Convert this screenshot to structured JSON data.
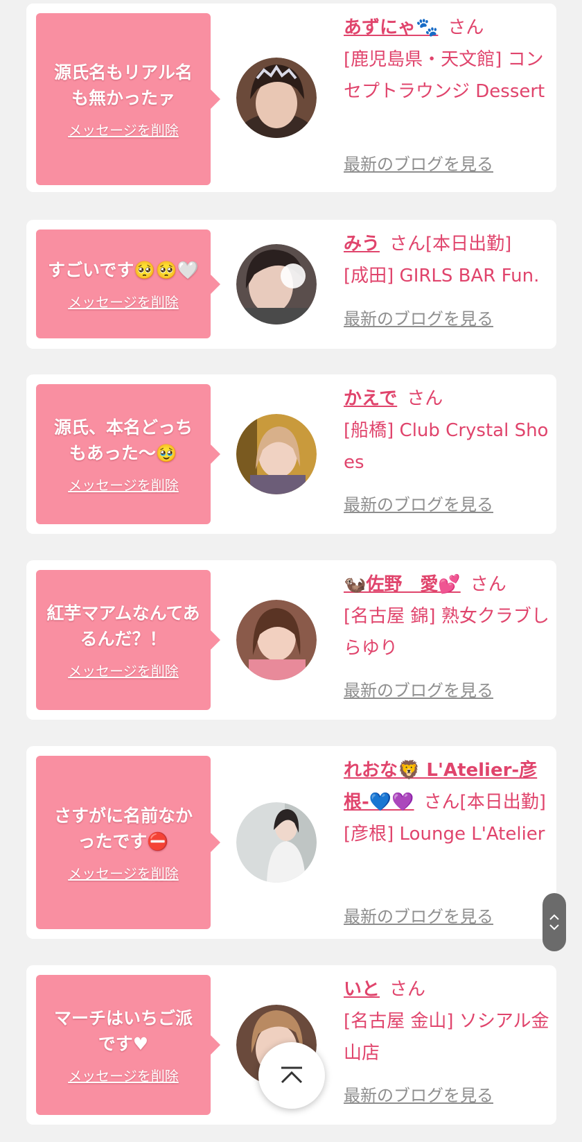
{
  "colors": {
    "background": "#f1f1f1",
    "bubble": "#f98fa1",
    "accent": "#e0446c",
    "link_gray": "#8e8e8e"
  },
  "items": [
    {
      "message": "源氏名もリアル名も無かったァ",
      "delete_label": "メッセージを削除",
      "name": "あずにゃ🐾",
      "suffix": "さん",
      "shop": "[鹿児島県・天文館] コンセプトラウンジ Dessert",
      "blog_label": "最新のブログを見る"
    },
    {
      "message": "すごいです🥺🥺🤍",
      "delete_label": "メッセージを削除",
      "name": "みう",
      "suffix": "さん[本日出勤]",
      "shop": "[成田] GIRLS BAR Fun.",
      "blog_label": "最新のブログを見る"
    },
    {
      "message": "源氏、本名どっちもあった〜🥹",
      "delete_label": "メッセージを削除",
      "name": "かえで",
      "suffix": "さん",
      "shop": "[船橋] Club Crystal Shoes",
      "blog_label": "最新のブログを見る"
    },
    {
      "message": "紅芋マアムなんてあるんだ？！",
      "delete_label": "メッセージを削除",
      "name": "🦦佐野　愛💕",
      "suffix": "さん",
      "shop": "[名古屋 錦] 熟女クラブしらゆり",
      "blog_label": "最新のブログを見る"
    },
    {
      "message": "さすがに名前なかったです⛔",
      "delete_label": "メッセージを削除",
      "name": "れおな🦁 L'Atelier-彦根-💙💜",
      "suffix": "さん[本日出勤]",
      "shop": "[彦根] Lounge L'Atelier",
      "blog_label": "最新のブログを見る"
    },
    {
      "message": "マーチはいちご派です♥",
      "delete_label": "メッセージを削除",
      "name": "いと",
      "suffix": "さん",
      "shop": "[名古屋 金山] ソシアル金山店",
      "blog_label": "最新のブログを見る"
    }
  ],
  "controls": {
    "scroll_up_icon": "chevron-up-icon",
    "scroll_down_icon": "chevron-down-icon",
    "back_to_top_icon": "back-to-top-icon"
  }
}
